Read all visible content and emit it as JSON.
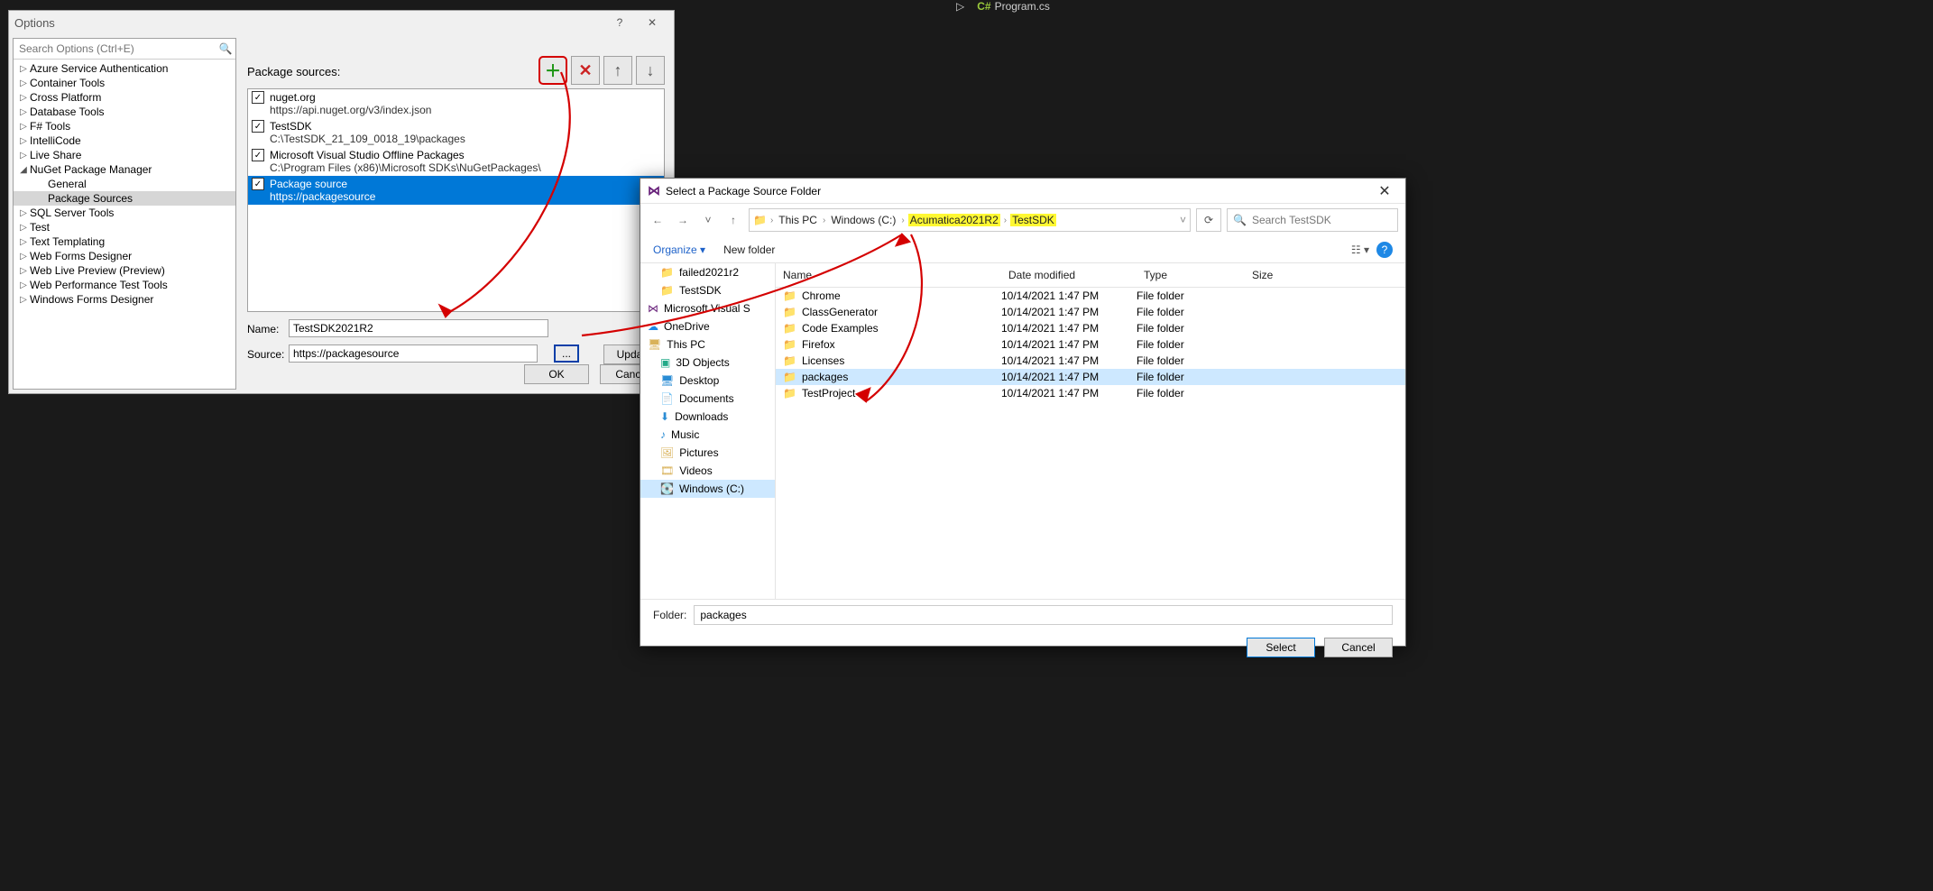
{
  "ide_tab": {
    "file": "Program.cs"
  },
  "options_dialog": {
    "title": "Options",
    "search_placeholder": "Search Options (Ctrl+E)",
    "tree": [
      {
        "label": "Azure Service Authentication",
        "exp": "▷"
      },
      {
        "label": "Container Tools",
        "exp": "▷"
      },
      {
        "label": "Cross Platform",
        "exp": "▷"
      },
      {
        "label": "Database Tools",
        "exp": "▷"
      },
      {
        "label": "F# Tools",
        "exp": "▷"
      },
      {
        "label": "IntelliCode",
        "exp": "▷"
      },
      {
        "label": "Live Share",
        "exp": "▷"
      },
      {
        "label": "NuGet Package Manager",
        "exp": "◢"
      },
      {
        "label": "General",
        "exp": "",
        "indent": true
      },
      {
        "label": "Package Sources",
        "exp": "",
        "indent": true,
        "selected": true
      },
      {
        "label": "SQL Server Tools",
        "exp": "▷"
      },
      {
        "label": "Test",
        "exp": "▷"
      },
      {
        "label": "Text Templating",
        "exp": "▷"
      },
      {
        "label": "Web Forms Designer",
        "exp": "▷"
      },
      {
        "label": "Web Live Preview (Preview)",
        "exp": "▷"
      },
      {
        "label": "Web Performance Test Tools",
        "exp": "▷"
      },
      {
        "label": "Windows Forms Designer",
        "exp": "▷"
      }
    ],
    "right_title": "Package sources:",
    "sources": [
      {
        "name": "nuget.org",
        "path": "https://api.nuget.org/v3/index.json",
        "checked": true
      },
      {
        "name": "TestSDK",
        "path": "C:\\TestSDK_21_109_0018_19\\packages",
        "checked": true
      },
      {
        "name": "Microsoft Visual Studio Offline Packages",
        "path": "C:\\Program Files (x86)\\Microsoft SDKs\\NuGetPackages\\",
        "checked": true
      },
      {
        "name": "Package source",
        "path": "https://packagesource",
        "checked": true,
        "selected": true
      }
    ],
    "name_lbl": "Name:",
    "source_lbl": "Source:",
    "name_value": "TestSDK2021R2",
    "source_value": "https://packagesource",
    "browse": "...",
    "update": "Update",
    "ok": "OK",
    "cancel": "Cancel"
  },
  "picker": {
    "title": "Select a Package Source Folder",
    "crumbs": [
      "This PC",
      "Windows (C:)",
      "Acumatica2021R2",
      "TestSDK"
    ],
    "search_placeholder": "Search TestSDK",
    "organize": "Organize",
    "newfolder": "New folder",
    "nav": [
      {
        "label": "failed2021r2",
        "icon": "📁",
        "indent": true
      },
      {
        "label": "TestSDK",
        "icon": "📁",
        "indent": true
      },
      {
        "label": "Microsoft Visual S",
        "icon": "⋈",
        "indent": false,
        "color": "#68217a"
      },
      {
        "label": "OneDrive",
        "icon": "☁",
        "indent": false,
        "color": "#1e88e5"
      },
      {
        "label": "This PC",
        "icon": "🖥",
        "indent": false
      },
      {
        "label": "3D Objects",
        "icon": "▣",
        "indent": true,
        "color": "#2a8"
      },
      {
        "label": "Desktop",
        "icon": "🖥",
        "indent": true,
        "color": "#2a8cd4"
      },
      {
        "label": "Documents",
        "icon": "📄",
        "indent": true
      },
      {
        "label": "Downloads",
        "icon": "⬇",
        "indent": true,
        "color": "#2a8cd4"
      },
      {
        "label": "Music",
        "icon": "♪",
        "indent": true,
        "color": "#2a8cd4"
      },
      {
        "label": "Pictures",
        "icon": "🖼",
        "indent": true
      },
      {
        "label": "Videos",
        "icon": "🎞",
        "indent": true
      },
      {
        "label": "Windows (C:)",
        "icon": "💽",
        "indent": true,
        "selected": true
      }
    ],
    "headers": {
      "name": "Name",
      "date": "Date modified",
      "type": "Type",
      "size": "Size"
    },
    "rows": [
      {
        "name": "Chrome",
        "date": "10/14/2021 1:47 PM",
        "type": "File folder"
      },
      {
        "name": "ClassGenerator",
        "date": "10/14/2021 1:47 PM",
        "type": "File folder"
      },
      {
        "name": "Code Examples",
        "date": "10/14/2021 1:47 PM",
        "type": "File folder"
      },
      {
        "name": "Firefox",
        "date": "10/14/2021 1:47 PM",
        "type": "File folder"
      },
      {
        "name": "Licenses",
        "date": "10/14/2021 1:47 PM",
        "type": "File folder"
      },
      {
        "name": "packages",
        "date": "10/14/2021 1:47 PM",
        "type": "File folder",
        "selected": true
      },
      {
        "name": "TestProject",
        "date": "10/14/2021 1:47 PM",
        "type": "File folder"
      }
    ],
    "folder_lbl": "Folder:",
    "folder_value": "packages",
    "select": "Select",
    "cancel": "Cancel"
  }
}
